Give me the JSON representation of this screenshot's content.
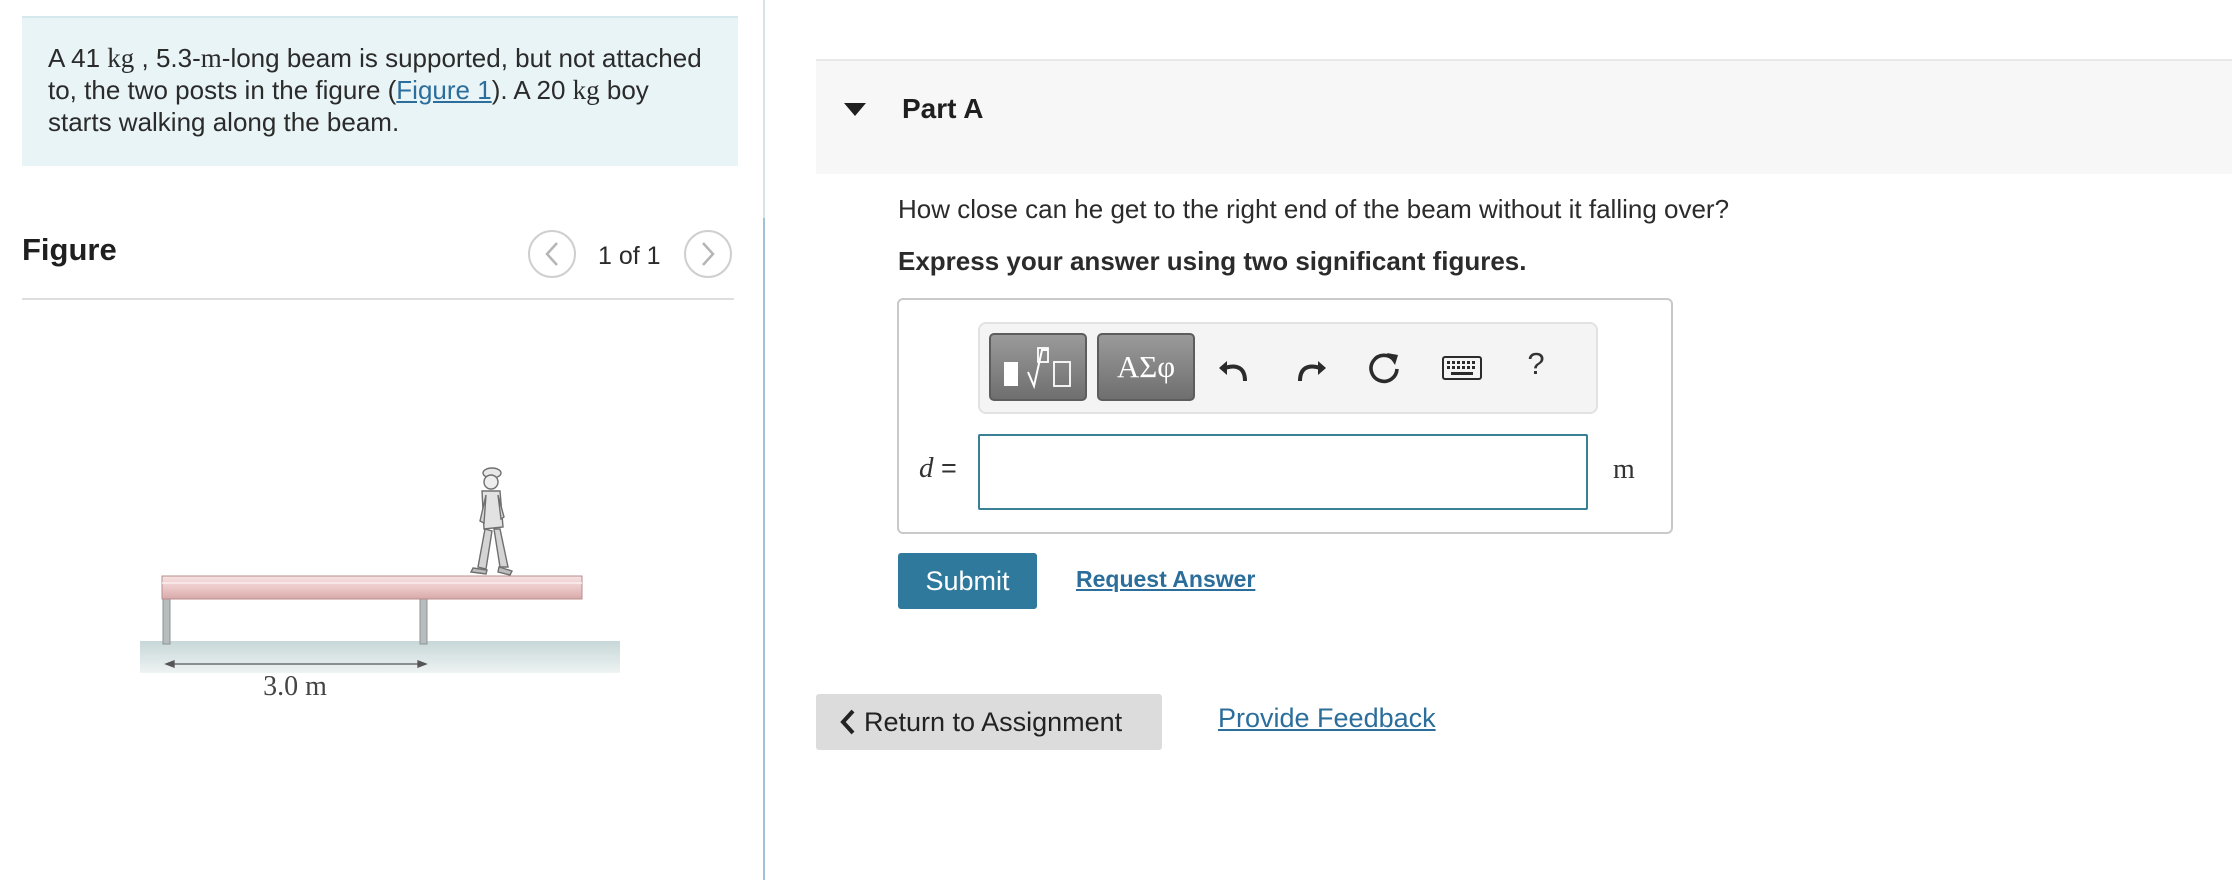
{
  "problem": {
    "prefix": "A 41 ",
    "mass_unit": "kg",
    "part2": " , 5.3-",
    "length_unit": "m",
    "part3": "-long beam is supported, but not attached to, the two posts in the figure (",
    "figure_link": "Figure 1",
    "part4": "). A 20 ",
    "mass_unit2": "kg",
    "part5": " boy starts walking along the beam."
  },
  "figure": {
    "title": "Figure",
    "counter": "1 of 1",
    "dimension_label": "3.0 m"
  },
  "part": {
    "title": "Part A",
    "question": "How close can he get to the right end of the beam without it falling over?",
    "instruction": "Express your answer using two significant figures."
  },
  "toolbar": {
    "greek_label": "ΑΣφ",
    "help_label": "?"
  },
  "answer": {
    "variable": "d",
    "equals": " =",
    "value": "",
    "unit": "m"
  },
  "actions": {
    "submit_label": "Submit",
    "request_answer_label": "Request Answer",
    "return_label": "Return to Assignment",
    "feedback_label": "Provide Feedback"
  },
  "colors": {
    "accent": "#2f7a9c",
    "link": "#2c6e9b",
    "problem_bg": "#e9f4f6"
  }
}
